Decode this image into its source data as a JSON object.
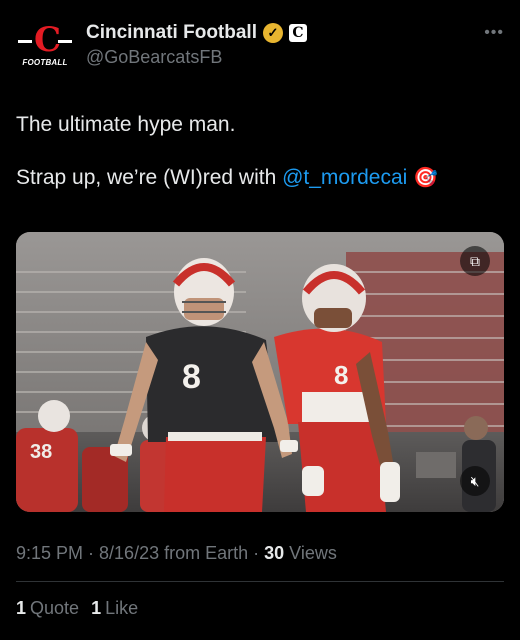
{
  "account": {
    "display_name": "Cincinnati Football",
    "handle": "@GoBearcatsFB",
    "avatar_letter": "C",
    "avatar_label": "FOOTBALL",
    "affiliate_letter": "C"
  },
  "tweet": {
    "line1": "The ultimate hype man.",
    "line2_prefix": "Strap up, we’re (WI)red with ",
    "mention": "@t_mordecai",
    "emoji": "🎯"
  },
  "media": {
    "jersey_front": "8",
    "jersey_right": "8",
    "jersey_left": "38"
  },
  "meta": {
    "time_date": "9:15 PM · 8/16/23 from Earth · ",
    "views_count": "30",
    "views_label": " Views"
  },
  "stats": {
    "quotes_count": "1",
    "quotes_label": "Quote",
    "likes_count": "1",
    "likes_label": "Like"
  },
  "colors": {
    "background": "#000000",
    "text": "#e7e9ea",
    "secondary": "#71767b",
    "link": "#1d9bf0",
    "brand_red": "#e31b23"
  },
  "icons": {
    "verified": "verified-gold-check-icon",
    "more": "more-options-icon",
    "gif": "gif-icon",
    "mute": "mute-icon"
  }
}
